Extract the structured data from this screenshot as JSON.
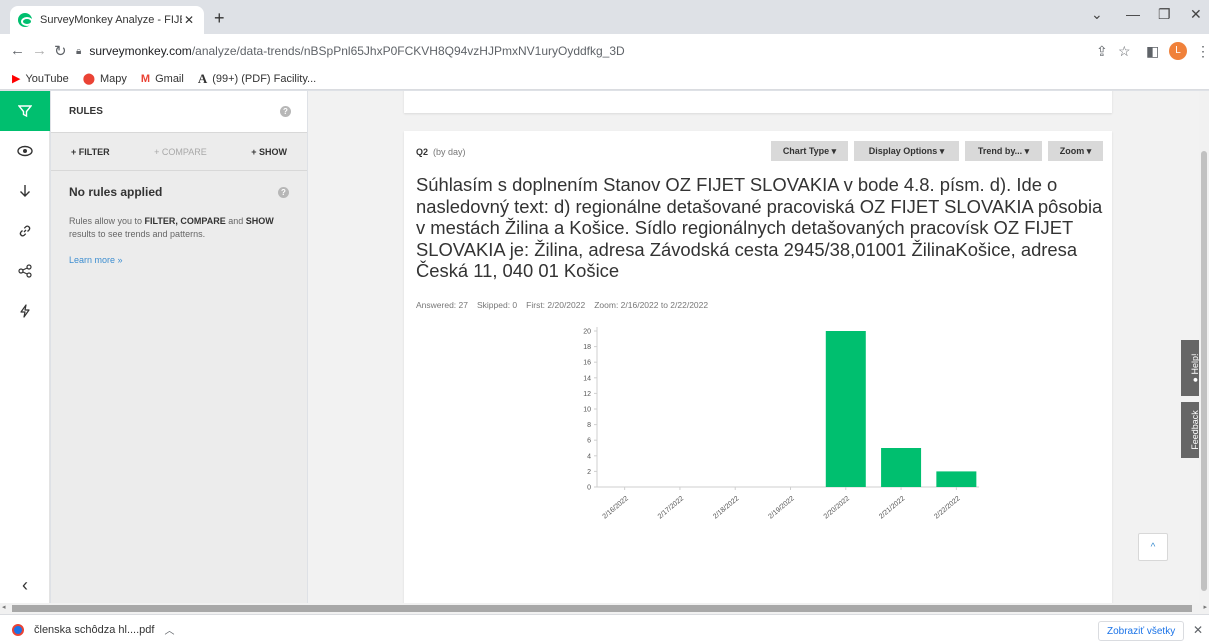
{
  "browser": {
    "tab_title": "SurveyMonkey Analyze - FIJET hl",
    "tab_close": "✕",
    "new_tab": "+",
    "url_host": "surveymonkey.com",
    "url_path": "/analyze/data-trends/nBSpPnl65JhxP0FCKVH8Q94vzHJPmxNV1uryOyddfkg_3D",
    "profile_initial": "L",
    "bookmarks": [
      {
        "icon": "youtube-icon",
        "label": "YouTube"
      },
      {
        "icon": "maps-icon",
        "label": "Mapy"
      },
      {
        "icon": "gmail-icon",
        "label": "Gmail"
      },
      {
        "icon": "bookmark-a-icon",
        "label": "(99+) (PDF) Facility..."
      }
    ]
  },
  "rail": {
    "items": [
      {
        "name": "filter-icon",
        "glyph": "▼",
        "active": true
      },
      {
        "name": "eye-icon",
        "glyph": "◉",
        "active": false
      },
      {
        "name": "download-arrow-icon",
        "glyph": "↓",
        "active": false
      },
      {
        "name": "link-icon",
        "glyph": "∞",
        "active": false
      },
      {
        "name": "share-icon",
        "glyph": "⋖",
        "active": false
      },
      {
        "name": "lightning-icon",
        "glyph": "ϟ",
        "active": false
      }
    ],
    "collapse": "‹"
  },
  "rules": {
    "title": "RULES",
    "filter": "+ FILTER",
    "compare": "+ COMPARE",
    "show": "+ SHOW",
    "none_title": "No rules applied",
    "desc_pre": "Rules allow you to ",
    "desc_filter": "FILTER, COMPARE",
    "desc_and": " and ",
    "desc_show": "SHOW",
    "desc_post": " results to see trends and patterns.",
    "learn_more": "Learn more »"
  },
  "question": {
    "id": "Q2",
    "granularity": "(by day)",
    "buttons": {
      "chart_type": "Chart Type ▾",
      "display_options": "Display Options ▾",
      "trend_by": "Trend by... ▾",
      "zoom": "Zoom ▾"
    },
    "title": "Súhlasím s  doplnením Stanov OZ FIJET SLOVAKIA v bode 4.8.  písm.  d). Ide o  nasledovný text:  d) regionálne detašované pracoviská  OZ FIJET SLOVAKIA pôsobia v mestách  Žilina a Košice. Sídlo regionálnych detašovaných pracovísk OZ FIJET SLOVAKIA je: Žilina, adresa Závodská cesta 2945/38,01001 ŽilinaKošice, adresa Česká 11, 040 01 Košice",
    "answered": "Answered: 27",
    "skipped": "Skipped: 0",
    "first": "First: 2/20/2022",
    "zoom": "Zoom: 2/16/2022 to 2/22/2022"
  },
  "chart_data": {
    "type": "bar",
    "categories": [
      "2/16/2022",
      "2/17/2022",
      "2/18/2022",
      "2/19/2022",
      "2/20/2022",
      "2/21/2022",
      "2/22/2022"
    ],
    "values": [
      0,
      0,
      0,
      0,
      20,
      5,
      2
    ],
    "yticks": [
      0,
      2,
      4,
      6,
      8,
      10,
      12,
      14,
      16,
      18,
      20
    ],
    "ylim": [
      0,
      20
    ],
    "color": "#00bf6f",
    "grid": false
  },
  "side": {
    "help": "Help!",
    "feedback": "Feedback",
    "scroll_top": "^"
  },
  "downloads": {
    "file": "členska schôdza hl....pdf",
    "show_all": "Zobraziť všetky",
    "close": "✕"
  }
}
